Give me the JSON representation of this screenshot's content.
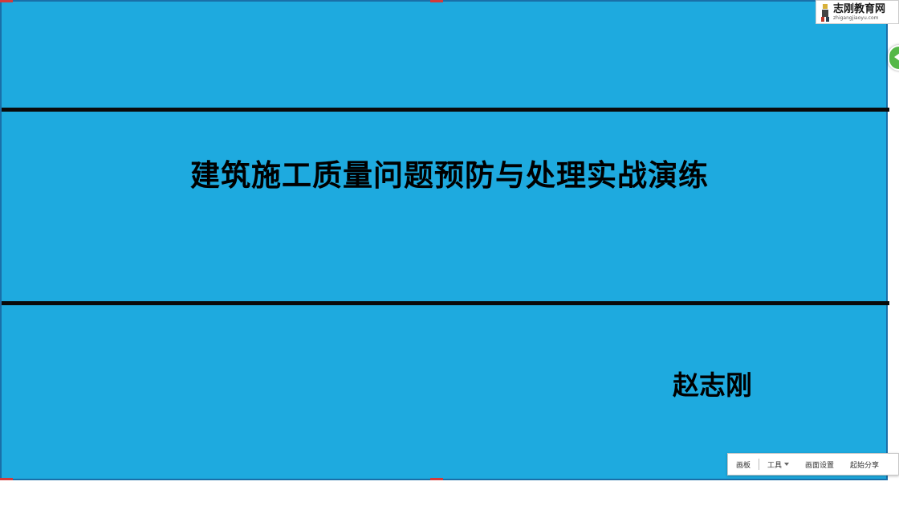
{
  "slide": {
    "title": "建筑施工质量问题预防与处理实战演练",
    "author": "赵志刚",
    "background_color": "#1eaadf",
    "rule_color": "#0a0a0a"
  },
  "logo": {
    "name": "志刚教育网",
    "url": "zhigangjiaoyu.com"
  },
  "side_button": {
    "icon": "arrow-left-icon",
    "color": "#55b848"
  },
  "toolbar": {
    "items": [
      {
        "label": "画板"
      },
      {
        "label": "工具"
      },
      {
        "label": "画面设置"
      },
      {
        "label": "起始分享"
      }
    ]
  }
}
